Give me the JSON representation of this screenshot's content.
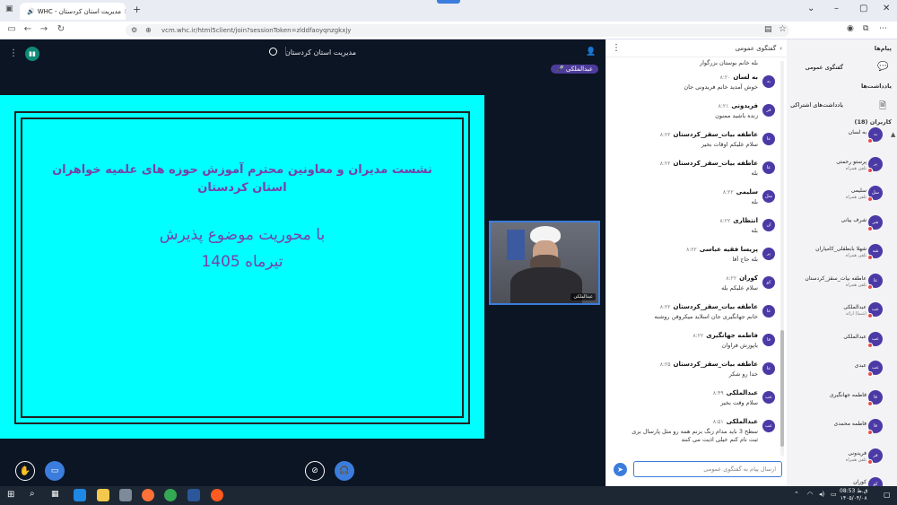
{
  "browser": {
    "tab_title": "WHC - مدیریت استان کردستان",
    "url": "vcm.whc.ir/html5client/join?sessionToken=zlddfaoyqnzgkxjy"
  },
  "meeting": {
    "title": "مدیریت استان کردستان",
    "host_badge": "عبدالملکی",
    "video_caption": "عبدالملکی"
  },
  "slide": {
    "line1": "نشست مدیران و معاونین محترم آموزش حوزه های علمیه خواهران",
    "line2": "استان کردستان",
    "line3": "با محوریت موضوع پذیرش",
    "line4": "تیرماه 1405"
  },
  "chat": {
    "header": "گفتگوی عمومی",
    "input_placeholder": "ارسال پیام به گفتگوی عمومی",
    "top_partial": "بله خانم بوستان بزرگوار",
    "messages": [
      {
        "avatar": "به",
        "name": "به لسان",
        "time": "۸:۲۰",
        "text": "خوش آمدید خانم فریدونی جان"
      },
      {
        "avatar": "فر",
        "name": "فریدونی",
        "time": "۸:۲۱",
        "text": "زنده باشید ممنون"
      },
      {
        "avatar": "عا",
        "name": "عاطفه بیات_سقز_کردستان",
        "time": "۸:۲۲",
        "text": "سلام علیکم اوقات بخیر"
      },
      {
        "avatar": "عا",
        "name": "عاطفه بیات_سقز_کردستان",
        "time": "۸:۲۲",
        "text": "بله"
      },
      {
        "avatar": "سل",
        "name": "سلیمی",
        "time": "۸:۲۲",
        "text": "بله"
      },
      {
        "avatar": "ان",
        "name": "انتظاری",
        "time": "۸:۲۲",
        "text": "بله"
      },
      {
        "avatar": "پر",
        "name": "پریسا فقیه عباسی",
        "time": "۸:۲۲",
        "text": "بله حاج آقا"
      },
      {
        "avatar": "کو",
        "name": "کوران",
        "time": "۸:۲۲",
        "text": "سلام علیکم بله"
      },
      {
        "avatar": "عا",
        "name": "عاطفه بیات_سقز_کردستان",
        "time": "۸:۲۲",
        "text": "خانم جهانگیری جان اسلاید میکروفن روشنه"
      },
      {
        "avatar": "فا",
        "name": "فاطمه جهانگیری",
        "time": "۸:۲۲",
        "text": "باپوزش فراوان"
      },
      {
        "avatar": "عا",
        "name": "عاطفه بیات_سقز_کردستان",
        "time": "۸:۲۵",
        "text": "خدا رو شکر"
      },
      {
        "avatar": "عب",
        "name": "عبدالملکی",
        "time": "۸:۴۹",
        "text": "سلام وقت بخیر"
      },
      {
        "avatar": "عب",
        "name": "عبدالملکی",
        "time": "۸:۵۱",
        "text": "سطح 3 باید مدام زنگ بزنم همه رو مثل پارسال بری ثبت نام کنم خیلی اذیت می کنند"
      }
    ]
  },
  "users": {
    "messages_title": "پیام‌ها",
    "public_chat": "گفتگوی عمومی",
    "notes_title": "یادداشت‌ها",
    "shared_notes": "یادداشت‌های اشتراکی",
    "users_title": "کاربران (18)",
    "list": [
      {
        "avatar": "به",
        "name": "به لسان",
        "sub": ""
      },
      {
        "avatar": "پر",
        "name": "پرستو رحمتی",
        "sub": "تلفن همراه"
      },
      {
        "avatar": "سل",
        "name": "سلیمی",
        "sub": "تلفن همراه"
      },
      {
        "avatar": "شر",
        "name": "شرف بیانی",
        "sub": ""
      },
      {
        "avatar": "شه",
        "name": "شهلا بابطفلی_کامیاران",
        "sub": "تلفن همراه"
      },
      {
        "avatar": "عا",
        "name": "عاطفه بیات_سقز_کردستان",
        "sub": "تلفن همراه"
      },
      {
        "avatar": "عب",
        "name": "عبدالملکی",
        "sub": "(شما) ارائه"
      },
      {
        "avatar": "عب",
        "name": "عبدالملکی",
        "sub": ""
      },
      {
        "avatar": "عب",
        "name": "عبدی",
        "sub": ""
      },
      {
        "avatar": "فا",
        "name": "فاطمه جهانگیری",
        "sub": ""
      },
      {
        "avatar": "فا",
        "name": "فاطمه محمدی",
        "sub": ""
      },
      {
        "avatar": "فر",
        "name": "فریدونی",
        "sub": "تلفن همراه"
      },
      {
        "avatar": "کو",
        "name": "کوران",
        "sub": "تلفن همراه"
      }
    ]
  },
  "taskbar": {
    "time": "08:53 ق.ظ",
    "date": "۱۴۰۵/۰۴/۰۸"
  },
  "colors": {
    "stage_bg": "#0c1524",
    "slide_bg": "#00ffff",
    "slide_title": "#7b3fa6",
    "accent": "#3b7ddd",
    "avatar": "#4b3aa6"
  }
}
